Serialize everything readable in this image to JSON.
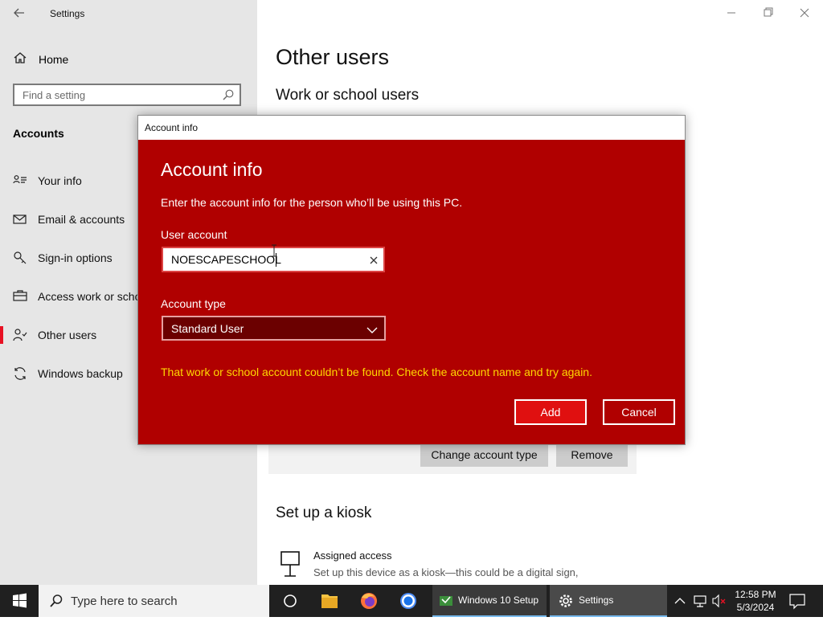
{
  "window": {
    "title": "Settings",
    "search_placeholder": "Find a setting"
  },
  "sidebar": {
    "home": "Home",
    "section": "Accounts",
    "items": [
      {
        "label": "Your info",
        "icon": "person-card-icon"
      },
      {
        "label": "Email & accounts",
        "icon": "mail-icon"
      },
      {
        "label": "Sign-in options",
        "icon": "key-icon"
      },
      {
        "label": "Access work or school",
        "icon": "briefcase-icon"
      },
      {
        "label": "Other users",
        "icon": "people-icon",
        "active": true
      },
      {
        "label": "Windows backup",
        "icon": "sync-icon"
      }
    ]
  },
  "main": {
    "title": "Other users",
    "work_heading": "Work or school users",
    "change_type_label": "Change account type",
    "remove_label": "Remove",
    "kiosk_heading": "Set up a kiosk",
    "kiosk_title": "Assigned access",
    "kiosk_desc": "Set up this device as a kiosk—this could be a digital sign,"
  },
  "dialog": {
    "window_title": "Account info",
    "heading": "Account info",
    "description": "Enter the account info for the person who’ll be using this PC.",
    "user_account_label": "User account",
    "user_account_value": "NOESCAPESCHOOL",
    "account_type_label": "Account type",
    "account_type_value": "Standard User",
    "error": "That work or school account couldn’t be found. Check the account name and try again.",
    "add_label": "Add",
    "cancel_label": "Cancel"
  },
  "taskbar": {
    "search_placeholder": "Type here to search",
    "apps": [
      {
        "label": "Windows 10 Setup"
      },
      {
        "label": "Settings"
      }
    ],
    "time": "12:58 PM",
    "date": "5/3/2024"
  },
  "colors": {
    "dialog_bg": "#b00000",
    "error_text": "#ffd700",
    "accent_red": "#e81123",
    "taskbar": "#202020"
  }
}
